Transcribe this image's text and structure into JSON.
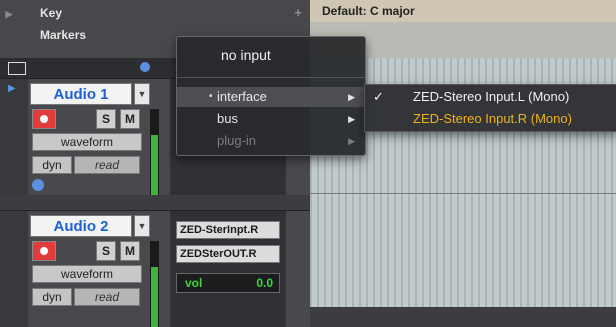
{
  "rulers": {
    "key_label": "Key",
    "markers_label": "Markers"
  },
  "key_signature": "Default: C major",
  "tracks": [
    {
      "name": "Audio 1",
      "solo": "S",
      "mute": "M",
      "view": "waveform",
      "dyn": "dyn",
      "automation": "read"
    },
    {
      "name": "Audio 2",
      "solo": "S",
      "mute": "M",
      "view": "waveform",
      "dyn": "dyn",
      "automation": "read",
      "input": "ZED-SterInpt.R",
      "output": "ZEDSterOUT.R",
      "vol_label": "vol",
      "vol_value": "0.0"
    }
  ],
  "input_menu": {
    "no_input": "no input",
    "items": [
      {
        "label": "interface",
        "highlighted": true
      },
      {
        "label": "bus"
      },
      {
        "label": "plug-in",
        "disabled": true
      }
    ]
  },
  "interface_submenu": {
    "items": [
      {
        "label": "ZED-Stereo Input.L (Mono)",
        "checked": true,
        "color": "#f2f2f2"
      },
      {
        "label": "ZED-Stereo Input.R (Mono)",
        "checked": false,
        "color": "#f0b21e"
      }
    ]
  },
  "colors": {
    "accent": "#1c62d6",
    "highlight": "#f0b21e",
    "record": "#e23b3b",
    "meter": "#3fb43d"
  }
}
